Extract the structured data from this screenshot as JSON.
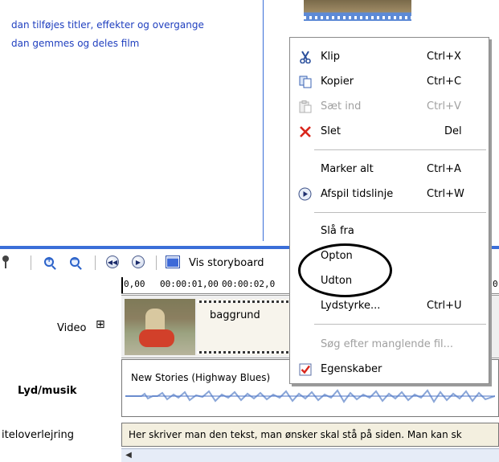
{
  "task_pane": {
    "links": [
      "dan tilføjes titler, effekter og overgange",
      "dan gemmes og deles film"
    ]
  },
  "toolbar": {
    "storyboard_label": "Vis storyboard",
    "icons": [
      "microphone-icon",
      "zoom-in-icon",
      "zoom-out-icon",
      "rewind-icon",
      "play-icon",
      "storyboard-icon"
    ]
  },
  "ruler": {
    "ticks": [
      "0,00",
      "00:00:01,00",
      "00:00:02,0",
      "0"
    ]
  },
  "tracks": {
    "video_label": "Video",
    "video_expand": "⊞",
    "audio_label": "Lyd/musik",
    "title_label": "iteloverlejring"
  },
  "clips": {
    "video_clip_title": "baggrund",
    "audio_clip_title": "New Stories (Highway Blues)",
    "title_overlay_text": "Her skriver man den tekst, man ønsker skal stå på siden. Man kan sk"
  },
  "context_menu": {
    "items": [
      {
        "label": "Klip",
        "shortcut": "Ctrl+X",
        "icon": "scissors-icon",
        "enabled": true
      },
      {
        "label": "Kopier",
        "shortcut": "Ctrl+C",
        "icon": "copy-icon",
        "enabled": true
      },
      {
        "label": "Sæt ind",
        "shortcut": "Ctrl+V",
        "icon": "paste-icon",
        "enabled": false
      },
      {
        "label": "Slet",
        "shortcut": "Del",
        "icon": "delete-x-icon",
        "enabled": true
      },
      {
        "label": "Marker alt",
        "shortcut": "Ctrl+A",
        "icon": "",
        "enabled": true
      },
      {
        "label": "Afspil tidslinje",
        "shortcut": "Ctrl+W",
        "icon": "play-circle-icon",
        "enabled": true
      },
      {
        "label": "Slå fra",
        "shortcut": "",
        "icon": "",
        "enabled": true
      },
      {
        "label": "Opton",
        "shortcut": "",
        "icon": "",
        "enabled": true
      },
      {
        "label": "Udton",
        "shortcut": "",
        "icon": "",
        "enabled": true
      },
      {
        "label": "Lydstyrke...",
        "shortcut": "Ctrl+U",
        "icon": "",
        "enabled": true
      },
      {
        "label": "Søg efter manglende fil...",
        "shortcut": "",
        "icon": "",
        "enabled": false
      },
      {
        "label": "Egenskaber",
        "shortcut": "",
        "icon": "properties-check-icon",
        "enabled": true
      }
    ]
  },
  "colors": {
    "link": "#1f3fbf",
    "accent_blue": "#3a6ed8",
    "delete_red": "#d9261c"
  }
}
